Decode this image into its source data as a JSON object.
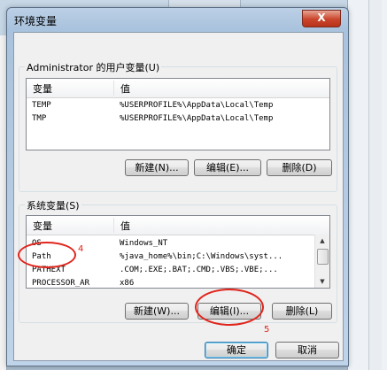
{
  "window": {
    "title": "环境变量",
    "close_label": "X"
  },
  "user_vars": {
    "group_label": "Administrator 的用户变量(U)",
    "columns": [
      "变量",
      "值"
    ],
    "rows": [
      {
        "name": "TEMP",
        "value": "%USERPROFILE%\\AppData\\Local\\Temp"
      },
      {
        "name": "TMP",
        "value": "%USERPROFILE%\\AppData\\Local\\Temp"
      }
    ],
    "buttons": {
      "new": "新建(N)...",
      "edit": "编辑(E)...",
      "delete": "删除(D)"
    }
  },
  "system_vars": {
    "group_label": "系统变量(S)",
    "columns": [
      "变量",
      "值"
    ],
    "rows": [
      {
        "name": "OS",
        "value": "Windows_NT"
      },
      {
        "name": "Path",
        "value": "%java_home%\\bin;C:\\Windows\\syst..."
      },
      {
        "name": "PATHEXT",
        "value": ".COM;.EXE;.BAT;.CMD;.VBS;.VBE;..."
      },
      {
        "name": "PROCESSOR_AR",
        "value": "x86"
      }
    ],
    "buttons": {
      "new": "新建(W)...",
      "edit": "编辑(I)...",
      "delete": "删除(L)"
    }
  },
  "dialog_buttons": {
    "ok": "确定",
    "cancel": "取消"
  },
  "annotations": {
    "step4": "4",
    "step5": "5",
    "color": "#e0251c"
  }
}
